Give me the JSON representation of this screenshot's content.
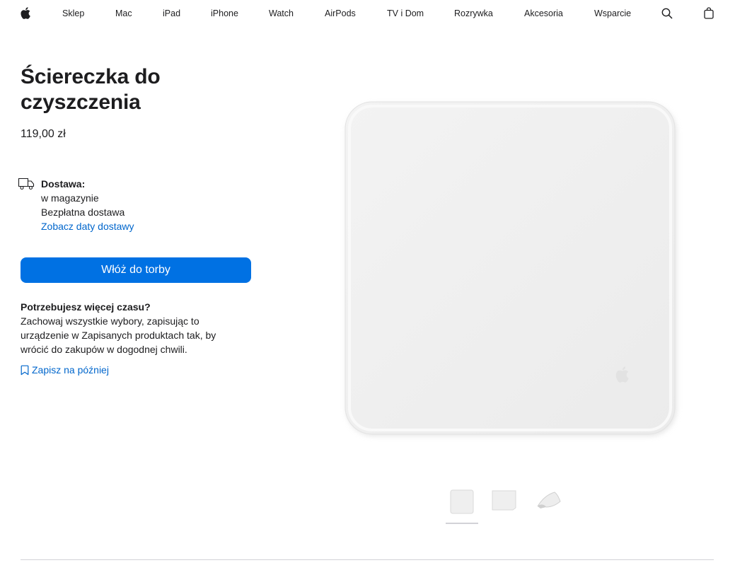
{
  "nav": {
    "logo_icon": "apple-logo-icon",
    "items": [
      "Sklep",
      "Mac",
      "iPad",
      "iPhone",
      "Watch",
      "AirPods",
      "TV i Dom",
      "Rozrywka",
      "Akcesoria",
      "Wsparcie"
    ],
    "search_icon": "search-icon",
    "bag_icon": "shopping-bag-icon"
  },
  "product": {
    "title_lines": [
      "Ściereczka do",
      "czyszczenia"
    ],
    "price": "119,00 zł"
  },
  "delivery": {
    "icon": "truck-icon",
    "label": "Dostawa:",
    "stock": "w magazynie",
    "shipping": "Bezpłatna dostawa",
    "dates_link": "Zobacz daty dostawy"
  },
  "actions": {
    "add_to_bag": "Włóż do torby"
  },
  "save": {
    "heading": "Potrzebujesz więcej czasu?",
    "body": "Zachowaj wszystkie wybory, zapisując to urządzenie w Zapisanych produktach tak, by wrócić do zakupów w dogodnej chwili.",
    "link": "Zapisz na później",
    "link_icon": "bookmark-icon"
  },
  "gallery": {
    "thumbnail_count": 3,
    "selected_index": 0
  },
  "colors": {
    "accent": "#0071e3",
    "link": "#0066cc",
    "text": "#1d1d1f"
  }
}
